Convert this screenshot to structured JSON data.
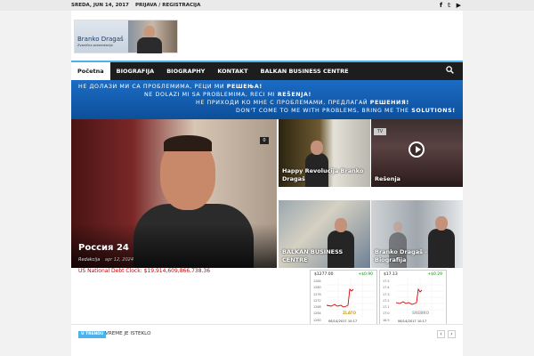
{
  "topbar": {
    "date": "SREDA, JUN 14, 2017",
    "login": "PRIJAVA / REGISTRACIJA"
  },
  "logo": {
    "name": "Branko Dragaš",
    "tagline": "Zvanična prezentacija"
  },
  "nav": {
    "items": [
      {
        "label": "Početna"
      },
      {
        "label": "BIOGRAFIJA"
      },
      {
        "label": "BIOGRAPHY"
      },
      {
        "label": "KONTAKT"
      },
      {
        "label": "BALKAN BUSINESS CENTRE"
      }
    ]
  },
  "banner": {
    "lines": [
      {
        "text": "НЕ ДОЛАЗИ МИ СА ПРОБЛЕМИМА, РЕЦИ МИ ",
        "bold": "РЕШЕЊА!"
      },
      {
        "text": "NE DOLAZI MI SA PROBLEMIMA, RECI MI ",
        "bold": "REŠENJA!"
      },
      {
        "text": "НЕ ПРИХОДИ КО МНЕ С ПРОБЛЕМАМИ, ПРЕДЛАГАЙ ",
        "bold": "РЕШЕНИЯ!"
      },
      {
        "text": "DON'T COME TO ME WITH PROBLEMS, BRING ME THE ",
        "bold": "SOLUTIONS!"
      }
    ]
  },
  "feature": {
    "title": "Россия 24",
    "author": "Redakcija",
    "date": "apr 12, 2024",
    "comments": "0"
  },
  "thumbs": [
    {
      "caption": "Happy Revolucija Branko Dragaš"
    },
    {
      "caption": "Rešenja"
    },
    {
      "caption": "BALKAN BUSINESS CENTRE"
    },
    {
      "caption": "Branko Dragaš - Biografija"
    }
  ],
  "debt_clock": "US National Debt Clock: $19,914,609,866,738.36",
  "widgets": [
    {
      "price": "$1277.00",
      "change": "+$0.90",
      "ylabels": [
        "1284",
        "1280",
        "1276",
        "1272",
        "1268",
        "1264",
        "1260"
      ],
      "metal": "ZLATO",
      "timestamp": "06/14/2017 10:17",
      "metal_color": "#d4a017"
    },
    {
      "price": "$17.13",
      "change": "+$0.29",
      "ylabels": [
        "17.5",
        "17.4",
        "17.3",
        "17.2",
        "17.1",
        "17.0",
        "16.9"
      ],
      "metal": "SREBRO",
      "timestamp": "06/14/2017 10:17",
      "metal_color": "#aaaaaa"
    }
  ],
  "ticker": {
    "tag": "U TRENDU",
    "message": "VREME JE ISTEKLO",
    "prev": "‹",
    "next": "›"
  },
  "colors": {
    "accent": "#4db2ec",
    "nav_bg": "#1d1d1d",
    "banner_bg": "#1b6cc4",
    "debt_text": "#cc0000"
  }
}
